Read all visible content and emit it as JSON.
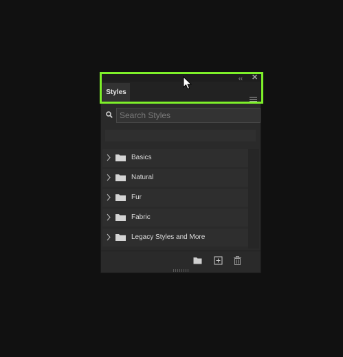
{
  "panel": {
    "tab_label": "Styles",
    "collapse_glyph": "‹‹",
    "close_glyph": "✕",
    "search": {
      "placeholder": "Search Styles",
      "value": ""
    },
    "items": [
      {
        "label": "Basics"
      },
      {
        "label": "Natural"
      },
      {
        "label": "Fur"
      },
      {
        "label": "Fabric"
      },
      {
        "label": "Legacy Styles and More"
      }
    ],
    "footer_icons": [
      "new-group-icon",
      "new-style-icon",
      "trash-icon"
    ]
  },
  "colors": {
    "highlight": "#7ef02a",
    "panel_bg": "#2a2a2a",
    "page_bg": "#111111"
  }
}
